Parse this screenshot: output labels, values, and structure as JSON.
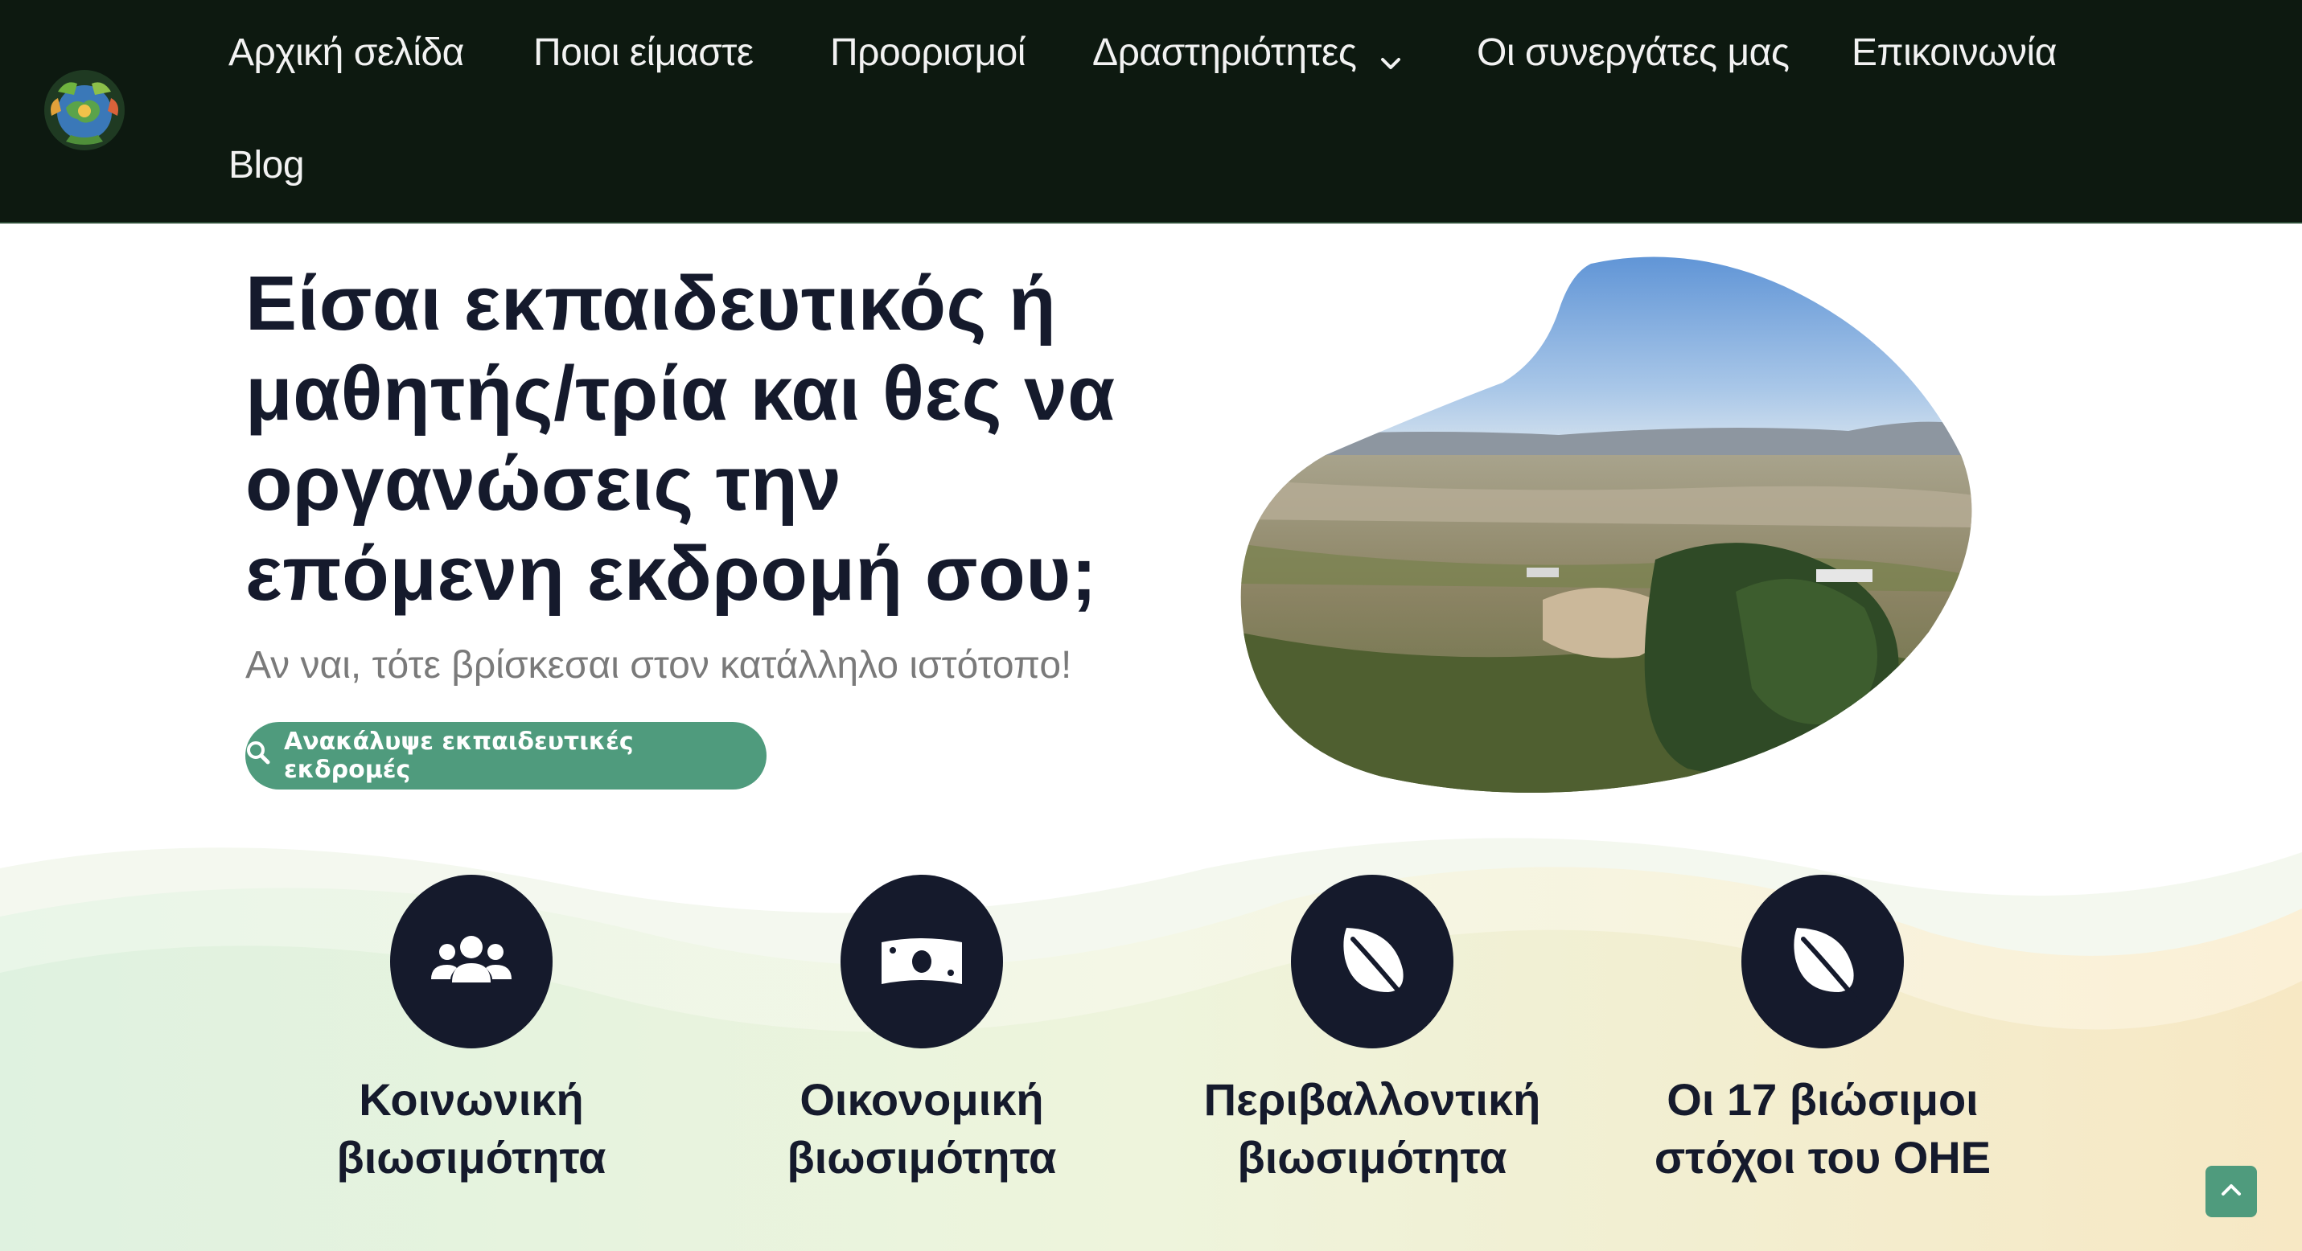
{
  "header": {
    "logo_icon": "globe-nature-logo-icon",
    "nav": [
      {
        "label": "Αρχική σελίδα"
      },
      {
        "label": "Ποιοι είμαστε"
      },
      {
        "label": "Προορισμοί"
      },
      {
        "label": "Δραστηριότητες",
        "has_dropdown": true
      },
      {
        "label": "Οι συνεργάτες μας"
      },
      {
        "label": "Επικοινωνία"
      },
      {
        "label": "Blog"
      }
    ],
    "bg_color": "#0d1910"
  },
  "hero": {
    "title": "Είσαι εκπαιδευτικός ή μαθητής/τρία και θες να οργανώσεις την επόμενη εκδρομή σου;",
    "subtitle": "Αν ναι, τότε βρίσκεσαι στον κατάλληλο ιστότοπο!",
    "cta_label": "Ανακάλυψε εκπαιδευτικές εκδρομές",
    "cta_icon": "search-icon",
    "cta_color": "#4f9b7d",
    "image_alt": "landscape-photo"
  },
  "features": [
    {
      "icon": "users-icon",
      "title_line1": "Κοινωνική",
      "title_line2": "βιωσιμότητα"
    },
    {
      "icon": "money-bill-icon",
      "title_line1": "Οικονομική",
      "title_line2": "βιωσιμότητα"
    },
    {
      "icon": "leaf-icon",
      "title_line1": "Περιβαλλοντική",
      "title_line2": "βιωσιμότητα"
    },
    {
      "icon": "leaf-icon",
      "title_line1": "Οι 17 βιώσιμοι",
      "title_line2": "στόχοι του ΟΗΕ"
    }
  ],
  "scroll_top_icon": "chevron-up-icon",
  "colors": {
    "dark_navy": "#151a2c",
    "accent_green": "#4f9b7d"
  }
}
